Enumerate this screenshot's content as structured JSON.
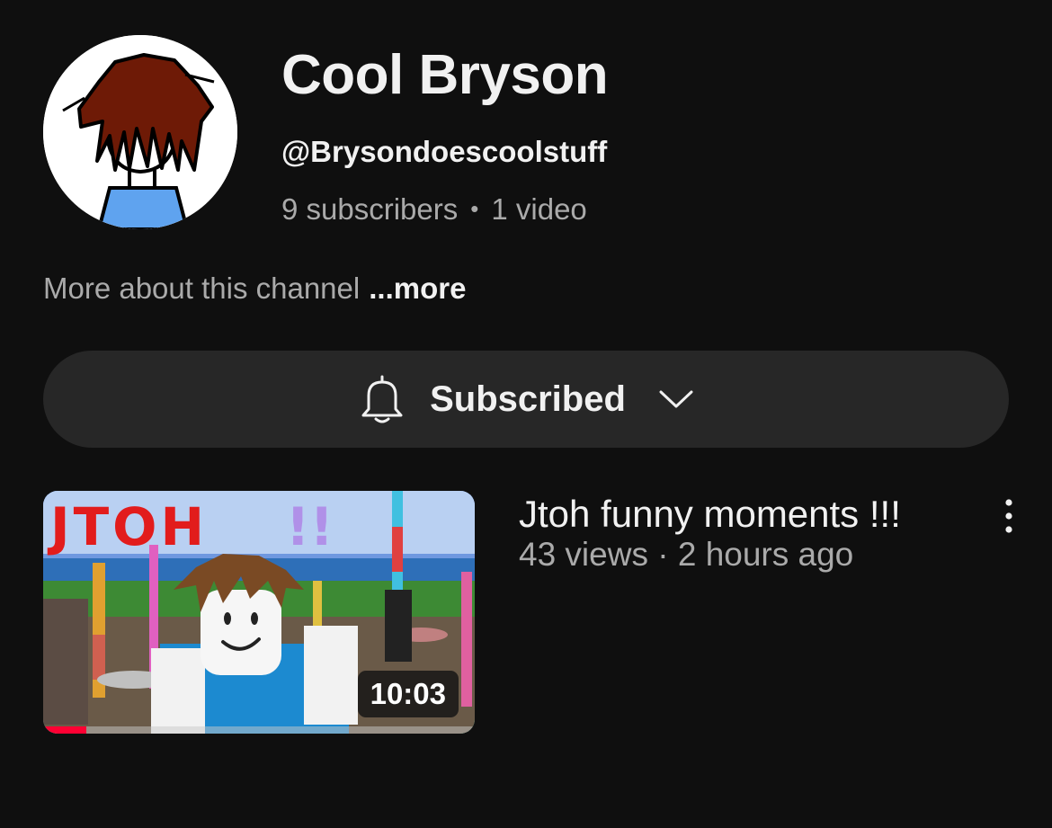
{
  "channel": {
    "name": "Cool Bryson",
    "handle": "@Brysondoescoolstuff",
    "subscribers": "9 subscribers",
    "separator": "•",
    "video_count": "1 video",
    "about_text": "More about this channel",
    "more_label": "...more"
  },
  "subscribe_button": {
    "label": "Subscribed",
    "icon": "bell-icon",
    "dropdown_icon": "chevron-down-icon"
  },
  "videos": [
    {
      "title": "Jtoh funny moments !!!",
      "meta": "43 views · 2 hours ago",
      "duration": "10:03",
      "thumbnail_text": "JTOH !!",
      "watched_fraction": 0.1
    }
  ],
  "colors": {
    "background": "#0f0f0f",
    "button_bg": "#272727",
    "secondary_text": "#aaaaaa",
    "progress": "#ff0033"
  }
}
